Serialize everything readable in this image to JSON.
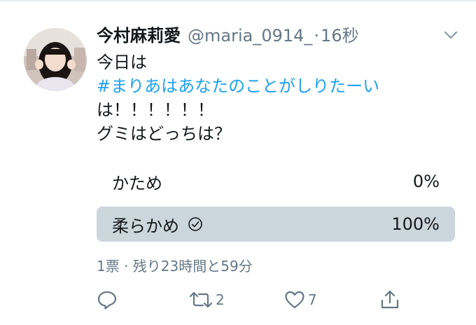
{
  "tweet": {
    "name": "今村麻莉愛",
    "handle": "@maria_0914_",
    "separator": "·",
    "time": "16秒",
    "lines": [
      "今日は",
      "#まりあはあなたのことがしりたーい",
      "は！！！！！！",
      "グミはどっちは？"
    ]
  },
  "poll": {
    "options": [
      {
        "label": "かため",
        "percent_text": "0%",
        "percent": 0,
        "selected": false
      },
      {
        "label": "柔らかめ",
        "percent_text": "100%",
        "percent": 100,
        "selected": true
      }
    ],
    "meta": "1票 · 残り23時間と59分"
  },
  "actions": {
    "reply_count": "",
    "retweet_count": "2",
    "like_count": "7"
  },
  "colors": {
    "text": "#14171a",
    "secondary": "#657786",
    "link": "#1da1f2",
    "poll_fill": "#ccd6dd"
  },
  "icons": [
    "avatar-image",
    "caret-down-icon",
    "check-circle-icon",
    "reply-icon",
    "retweet-icon",
    "heart-icon",
    "share-icon"
  ]
}
